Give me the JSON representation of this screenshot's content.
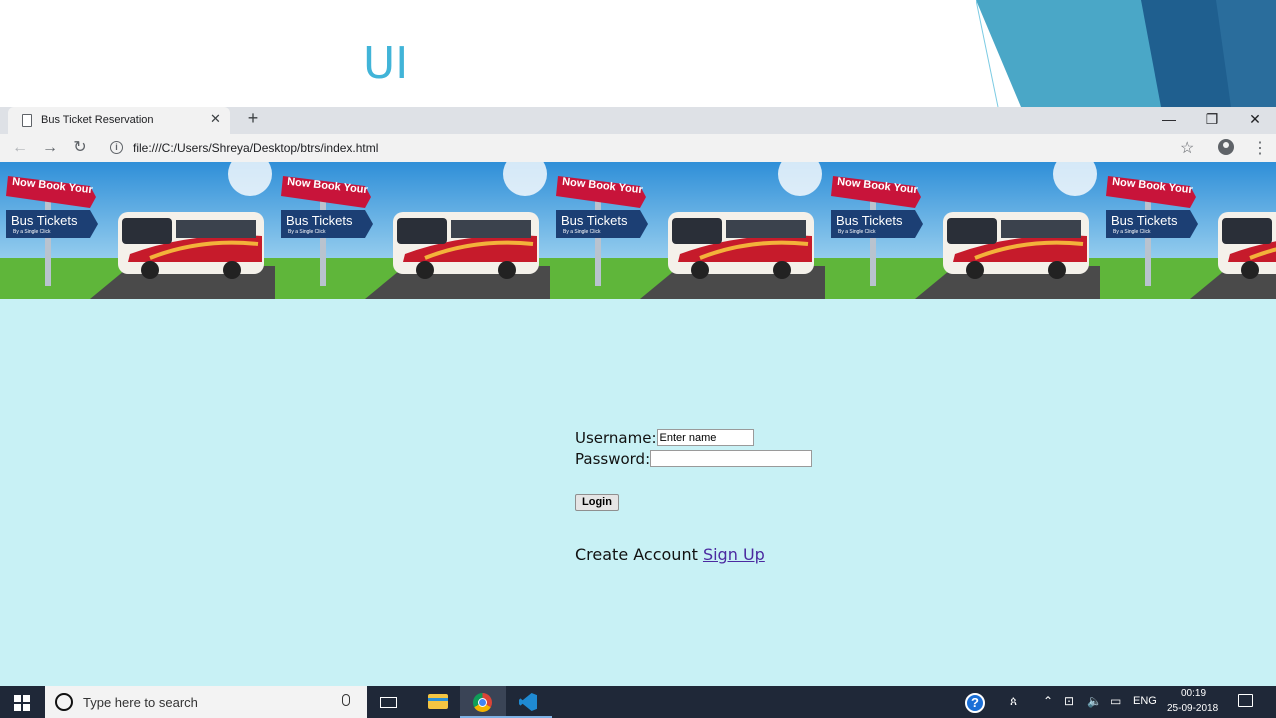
{
  "slide": {
    "title": "UI"
  },
  "browser": {
    "tab_title": "Bus Ticket Reservation",
    "tab_close": "✕",
    "new_tab": "+",
    "url": "file:///C:/Users/Shreya/Desktop/btrs/index.html",
    "window_controls": {
      "minimize": "—",
      "restore": "❐",
      "close": "✕"
    },
    "nav": {
      "back": "←",
      "forward": "→",
      "reload": "↻"
    },
    "star": "☆",
    "menu": "⋮"
  },
  "banner": {
    "tile_count": 5,
    "sign_top": "Now Book Your",
    "sign_bottom": "Bus Tickets",
    "sign_sub": "By a Single Click"
  },
  "login_form": {
    "username_label": "Username:",
    "username_value": "Enter name",
    "password_label": "Password:",
    "password_value": "",
    "login_button": "Login",
    "create_account_text": "Create Account",
    "signup_link": "Sign Up"
  },
  "taskbar": {
    "search_placeholder": "Type here to search",
    "tray_language": "ENG",
    "time": "00:19",
    "date": "25-09-2018"
  },
  "colors": {
    "page_background": "#c8f1f5",
    "slide_title": "#41b4d8",
    "link": "#4b2aa0"
  }
}
